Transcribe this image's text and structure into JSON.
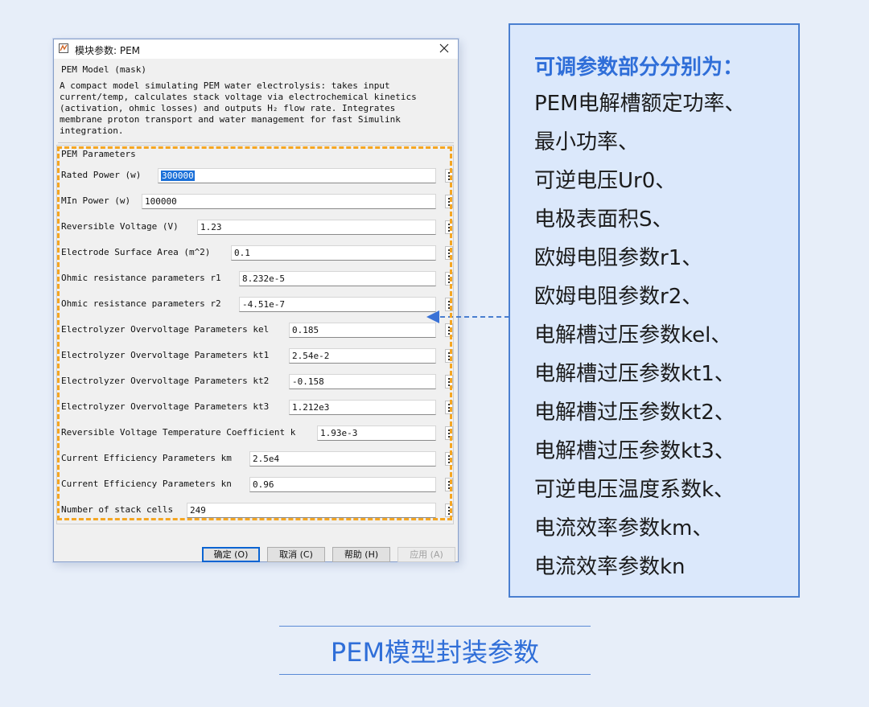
{
  "dialog": {
    "title": "模块参数: PEM",
    "mask_title": "PEM Model (mask)",
    "description": "A compact model simulating PEM water electrolysis: takes input\ncurrent/temp, calculates stack voltage via electrochemical kinetics\n(activation, ohmic losses) and outputs H₂ flow rate. Integrates\nmembrane proton transport and water management for fast Simulink\nintegration.",
    "group_title": "PEM Parameters",
    "parameters": [
      {
        "label": "Rated Power (w)",
        "value": "300000"
      },
      {
        "label": "MIn Power (w)",
        "value": "100000"
      },
      {
        "label": "Reversible Voltage (V)",
        "value": "1.23"
      },
      {
        "label": "Electrode Surface Area (m^2)",
        "value": "0.1"
      },
      {
        "label": "Ohmic resistance parameters r1",
        "value": "8.232e-5"
      },
      {
        "label": "Ohmic resistance parameters r2",
        "value": "-4.51e-7"
      },
      {
        "label": "Electrolyzer Overvoltage Parameters kel",
        "value": "0.185"
      },
      {
        "label": "Electrolyzer Overvoltage Parameters kt1",
        "value": "2.54e-2"
      },
      {
        "label": "Electrolyzer Overvoltage Parameters kt2",
        "value": "-0.158"
      },
      {
        "label": "Electrolyzer Overvoltage Parameters kt3",
        "value": "1.212e3"
      },
      {
        "label": "Reversible Voltage Temperature Coefficient k",
        "value": "1.93e-3"
      },
      {
        "label": "Current Efficiency Parameters km",
        "value": "2.5e4"
      },
      {
        "label": "Current Efficiency Parameters kn",
        "value": "0.96"
      },
      {
        "label": "Number of stack cells",
        "value": "249"
      }
    ],
    "buttons": {
      "ok": "确定 (O)",
      "cancel": "取消 (C)",
      "help": "帮助 (H)",
      "apply": "应用 (A)"
    }
  },
  "annotation": {
    "heading": "可调参数部分分别为：",
    "items": [
      "PEM电解槽额定功率、",
      "最小功率、",
      "可逆电压Ur0、",
      "电极表面积S、",
      "欧姆电阻参数r1、",
      "欧姆电阻参数r2、",
      "电解槽过压参数kel、",
      "电解槽过压参数kt1、",
      "电解槽过压参数kt2、",
      "电解槽过压参数kt3、",
      "可逆电压温度系数k、",
      "电流效率参数km、",
      "电流效率参数kn"
    ]
  },
  "caption": "PEM模型封装参数",
  "colors": {
    "highlight": "#f5a623",
    "accent_blue": "#2f6ed8",
    "panel_bg": "#dbe8fb",
    "page_bg": "#e7eef9"
  }
}
